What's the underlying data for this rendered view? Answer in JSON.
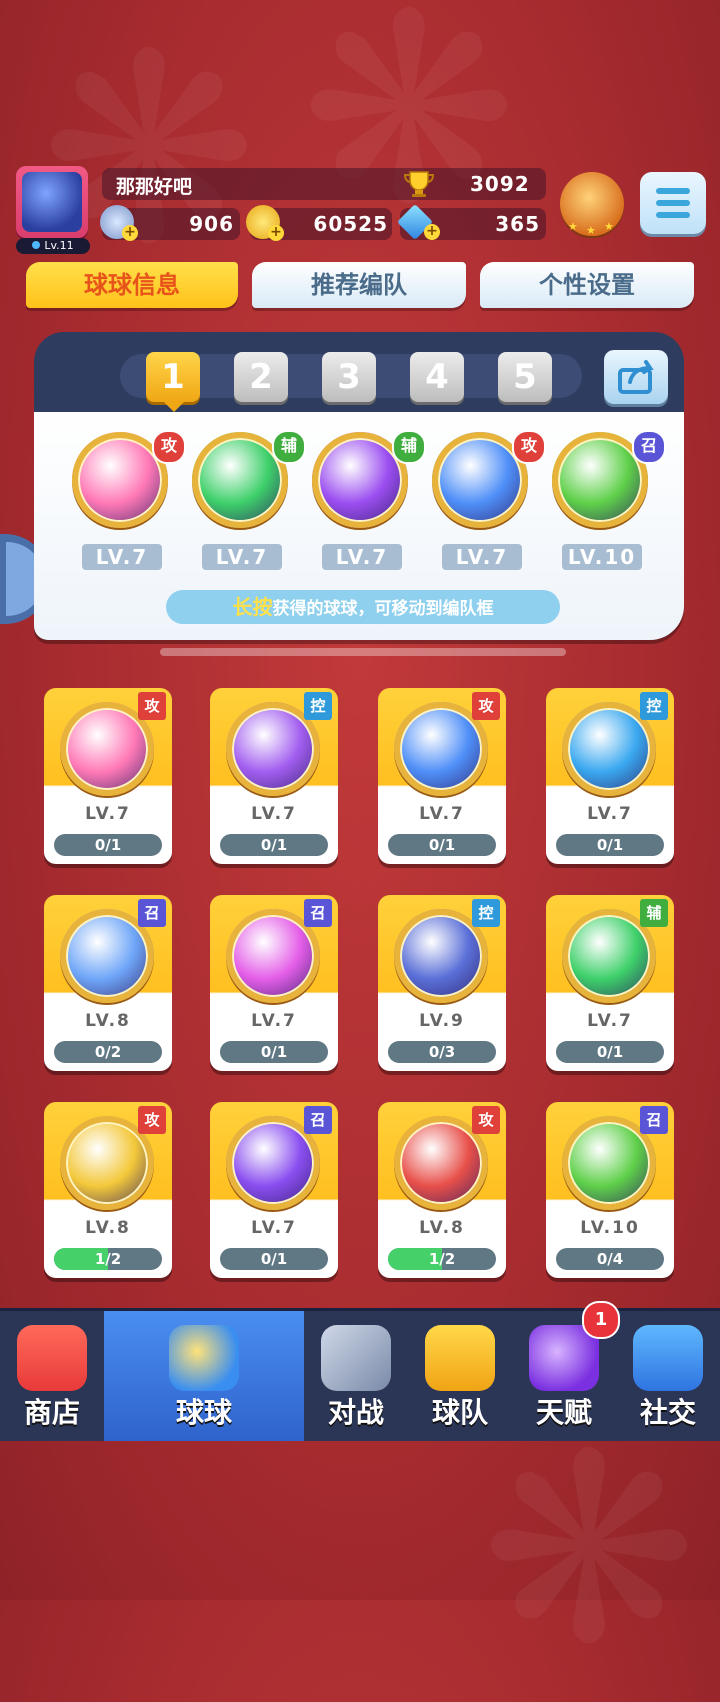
{
  "player": {
    "name": "那那好吧",
    "level": "Lv.11",
    "trophies": "3092",
    "stamina": "906",
    "gold": "60525",
    "gems": "365"
  },
  "tabs": [
    {
      "label": "球球信息",
      "active": true
    },
    {
      "label": "推荐编队",
      "active": false
    },
    {
      "label": "个性设置",
      "active": false
    }
  ],
  "team_slots": [
    "1",
    "2",
    "3",
    "4",
    "5"
  ],
  "active_slot": "1",
  "team": [
    {
      "tag": "攻",
      "level": "LV.7",
      "icon": "flame-burst-ball",
      "color": "#ff79b6"
    },
    {
      "tag": "辅",
      "level": "LV.7",
      "icon": "green-arrow-ball",
      "color": "#3ed06a"
    },
    {
      "tag": "辅",
      "level": "LV.7",
      "icon": "purple-leaf-ball",
      "color": "#9b4ef0"
    },
    {
      "tag": "攻",
      "level": "LV.7",
      "icon": "blue-vortex-ball",
      "color": "#4f8ff8"
    },
    {
      "tag": "召",
      "level": "LV.10",
      "icon": "green-star-ball",
      "color": "#5fd04a"
    }
  ],
  "hint": {
    "highlight": "长按",
    "text": "获得的球球，可移动到编队框"
  },
  "cards": [
    {
      "tag": "攻",
      "type": "atk",
      "level": "LV.7",
      "progress": "0/1",
      "fill": 0,
      "icon": "flame-burst-ball",
      "color": "#ff79b6"
    },
    {
      "tag": "控",
      "type": "ctl",
      "level": "LV.7",
      "progress": "0/1",
      "fill": 0,
      "icon": "purple-butterfly-ball",
      "color": "#a25ef0"
    },
    {
      "tag": "攻",
      "type": "atk",
      "level": "LV.7",
      "progress": "0/1",
      "fill": 0,
      "icon": "blue-vortex-ball",
      "color": "#4f8ff8"
    },
    {
      "tag": "控",
      "type": "ctl",
      "level": "LV.7",
      "progress": "0/1",
      "fill": 0,
      "icon": "cloud-wave-ball",
      "color": "#3aa8f0"
    },
    {
      "tag": "召",
      "type": "sum",
      "level": "LV.8",
      "progress": "0/2",
      "fill": 0,
      "icon": "whirlwind-ball",
      "color": "#6fa6f8"
    },
    {
      "tag": "召",
      "type": "sum",
      "level": "LV.7",
      "progress": "0/1",
      "fill": 0,
      "icon": "mushroom-ball",
      "color": "#e45ee8"
    },
    {
      "tag": "控",
      "type": "ctl",
      "level": "LV.9",
      "progress": "0/3",
      "fill": 0,
      "icon": "crescent-moon-ball",
      "color": "#5a6fd8"
    },
    {
      "tag": "辅",
      "type": "sup",
      "level": "LV.7",
      "progress": "0/1",
      "fill": 0,
      "icon": "green-arrow-ball",
      "color": "#3ed06a"
    },
    {
      "tag": "攻",
      "type": "atk",
      "level": "LV.8",
      "progress": "1/2",
      "fill": 0.5,
      "icon": "radiation-ball",
      "color": "#f3c83a"
    },
    {
      "tag": "召",
      "type": "sum",
      "level": "LV.7",
      "progress": "0/1",
      "fill": 0,
      "icon": "purple-orbit-ball",
      "color": "#8a4ef0"
    },
    {
      "tag": "攻",
      "type": "atk",
      "level": "LV.8",
      "progress": "1/2",
      "fill": 0.5,
      "icon": "fist-ball",
      "color": "#e8504a"
    },
    {
      "tag": "召",
      "type": "sum",
      "level": "LV.10",
      "progress": "0/4",
      "fill": 0,
      "icon": "green-star-ball",
      "color": "#5fd04a"
    }
  ],
  "nav": [
    {
      "label": "商店",
      "icon": "shop-icon",
      "active": false
    },
    {
      "label": "球球",
      "icon": "balls-icon",
      "active": true
    },
    {
      "label": "对战",
      "icon": "crossed-swords-icon",
      "active": false
    },
    {
      "label": "球队",
      "icon": "whistle-icon",
      "active": false
    },
    {
      "label": "天赋",
      "icon": "talent-orb-icon",
      "active": false,
      "badge": "1"
    },
    {
      "label": "社交",
      "icon": "chat-heart-icon",
      "active": false
    }
  ],
  "colors": {
    "background": "#b03236",
    "accent_yellow": "#ffc21a",
    "nav_active": "#2f63cc",
    "tag_attack": "#e0403a",
    "tag_control": "#2f9adb",
    "tag_support": "#3fae3f",
    "tag_summon": "#5a55d6"
  }
}
